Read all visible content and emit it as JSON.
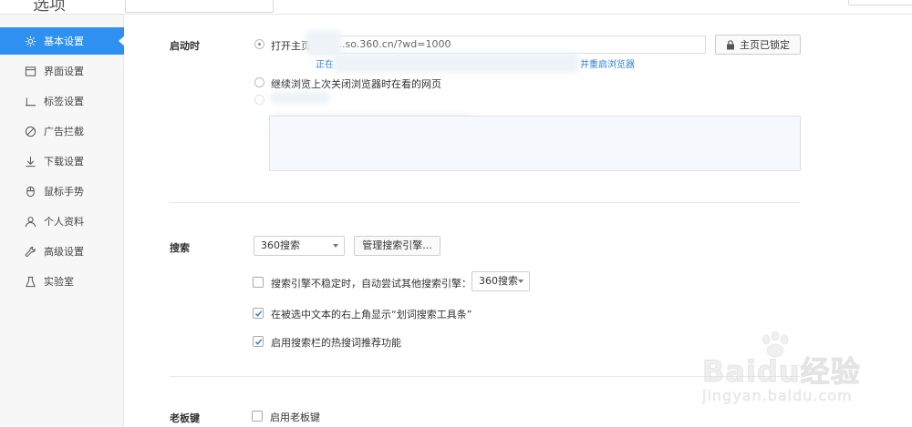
{
  "window": {
    "title": "选项"
  },
  "sidebar": {
    "items": [
      {
        "label": "基本设置",
        "icon": "gear-icon",
        "active": true
      },
      {
        "label": "界面设置",
        "icon": "window-icon",
        "active": false
      },
      {
        "label": "标签设置",
        "icon": "tab-icon",
        "active": false
      },
      {
        "label": "广告拦截",
        "icon": "block-icon",
        "active": false
      },
      {
        "label": "下载设置",
        "icon": "download-icon",
        "active": false
      },
      {
        "label": "鼠标手势",
        "icon": "mouse-icon",
        "active": false
      },
      {
        "label": "个人资料",
        "icon": "user-icon",
        "active": false
      },
      {
        "label": "高级设置",
        "icon": "wrench-icon",
        "active": false
      },
      {
        "label": "实验室",
        "icon": "flask-icon",
        "active": false
      }
    ]
  },
  "startup": {
    "label": "启动时",
    "option_homepage": "打开主页",
    "homepage_url": "...so.360.cn/?wd=1000",
    "lock_button": "主页已锁定",
    "hint_prefix": "正在",
    "hint_suffix": "并重启浏览器",
    "option_continue": "继续浏览上次关闭浏览器时在看的网页"
  },
  "search": {
    "label": "搜索",
    "engine_selected": "360搜索",
    "manage_button": "管理搜索引擎...",
    "fallback_label": "搜索引擎不稳定时，自动尝试其他搜索引擎：",
    "fallback_engine": "360搜索",
    "fallback_checked": false,
    "toolbar_label": "在被选中文本的右上角显示“划词搜索工具条”",
    "toolbar_checked": true,
    "hotwords_label": "启用搜索栏的热搜词推荐功能",
    "hotwords_checked": true
  },
  "bosskey": {
    "label": "老板键",
    "enable_label": "启用老板键",
    "enable_checked": false
  },
  "watermark": {
    "brand": "Bai",
    "brand2": "du",
    "brand_cn": "经验",
    "url": "jingyan.baidu.com"
  },
  "colors": {
    "accent": "#2e91f1",
    "link": "#2e7fd6"
  }
}
